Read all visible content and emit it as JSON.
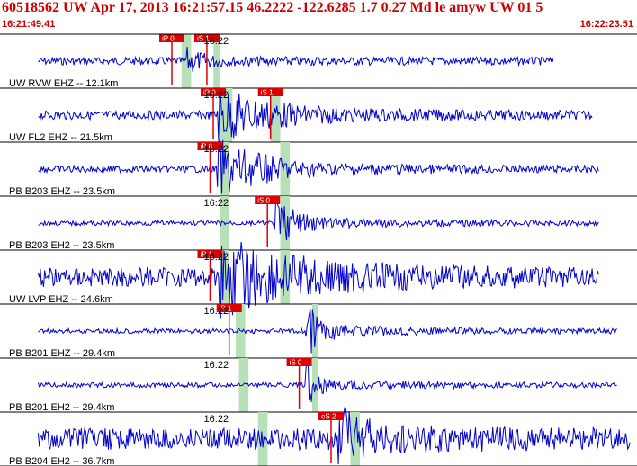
{
  "header": {
    "title": "60518562 UW Apr 17, 2013 16:21:57.15   46.2222 -122.6285  1.7 0.27 Md le amyw UW 01   5",
    "time_start": "16:21:49.41",
    "time_end": "16:22:23.51"
  },
  "colors": {
    "title": "#cc0000",
    "trace": "#0000cc",
    "pick": "#dd0000",
    "band": "#b8e0b8",
    "rule": "#000000"
  },
  "chart_data": {
    "type": "line",
    "title": "60518562 UW Apr 17, 2013 16:21:57.15   46.2222 -122.6285  1.7 0.27 Md le amyw UW 01   5",
    "x_range": [
      "16:21:49.41",
      "16:22:23.51"
    ],
    "traces": [
      {
        "label": "UW RVW EHZ -- 12.1km",
        "time_label": "16:22",
        "picks": [
          "iP 0",
          "iS 1"
        ],
        "amp": 0.25,
        "noise": 0.08,
        "sig_start": 0.29,
        "sig_end": 0.36,
        "trace_end": 0.87
      },
      {
        "label": "UW FL2 EHZ -- 21.5km",
        "time_label": "16:22",
        "picks": [
          "iP 0",
          "iS 1"
        ],
        "amp": 0.55,
        "noise": 0.09,
        "sig_start": 0.34,
        "sig_end": 0.55,
        "trace_end": 0.93
      },
      {
        "label": "PB B203 EHZ -- 23.5km",
        "time_label": "16:22",
        "picks": [
          "iP 0"
        ],
        "amp": 0.6,
        "noise": 0.07,
        "sig_start": 0.34,
        "sig_end": 0.52,
        "trace_end": 0.94
      },
      {
        "label": "PB B203 EH2 -- 23.5km",
        "time_label": "16:22",
        "picks": [
          "iS 0"
        ],
        "amp": 0.5,
        "noise": 0.05,
        "sig_start": 0.43,
        "sig_end": 0.52,
        "trace_end": 0.94
      },
      {
        "label": "UW LVP EHZ -- 24.6km",
        "time_label": "16:22",
        "picks": [
          "iP 1"
        ],
        "amp": 0.75,
        "noise": 0.2,
        "sig_start": 0.34,
        "sig_end": 0.62,
        "trace_end": 0.94
      },
      {
        "label": "PB B201 EHZ -- 29.4km",
        "time_label": "16:22",
        "picks": [
          "iP 1"
        ],
        "amp": 0.55,
        "noise": 0.05,
        "sig_start": 0.48,
        "sig_end": 0.55,
        "trace_end": 0.97
      },
      {
        "label": "PB B201 EH2 -- 29.4km",
        "time_label": "16:22",
        "picks": [
          "iS 0"
        ],
        "amp": 0.45,
        "noise": 0.05,
        "sig_start": 0.48,
        "sig_end": 0.53,
        "trace_end": 0.97
      },
      {
        "label": "PB B204 EH2 -- 36.7km",
        "time_label": "16:22",
        "picks": [
          "eS 2"
        ],
        "amp": 0.7,
        "noise": 0.22,
        "sig_start": 0.53,
        "sig_end": 0.62,
        "trace_end": 0.99
      }
    ]
  }
}
